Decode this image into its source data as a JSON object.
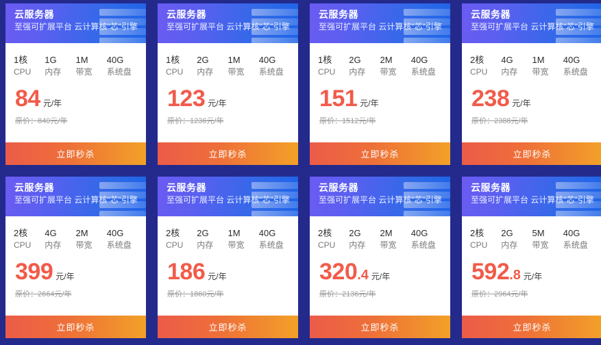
{
  "page": {
    "background_color": "#232a8c",
    "header_gradient": [
      "#6b5bf2",
      "#1f63e8"
    ],
    "button_gradient": [
      "#ec5b49",
      "#f2a128"
    ],
    "price_color": "#f15b4a"
  },
  "common": {
    "title": "云服务器",
    "subtitle": "至强可扩展平台 云计算核\"芯\"引擎",
    "buy_label": "立即秒杀",
    "price_unit": "元/年",
    "spec_labels": [
      "CPU",
      "内存",
      "带宽",
      "系统盘"
    ],
    "server-art-icon": "server-stack-icon"
  },
  "cards": [
    {
      "title": "云服务器",
      "subtitle": "至强可扩展平台 云计算核\"芯\"引擎",
      "specs": [
        {
          "value": "1核",
          "label": "CPU"
        },
        {
          "value": "1G",
          "label": "内存"
        },
        {
          "value": "1M",
          "label": "带宽"
        },
        {
          "value": "40G",
          "label": "系统盘"
        }
      ],
      "price_int": "84",
      "price_dec": "",
      "price_unit": "元/年",
      "original_price": "原价：840元/年",
      "buy_label": "立即秒杀"
    },
    {
      "title": "云服务器",
      "subtitle": "至强可扩展平台 云计算核\"芯\"引擎",
      "specs": [
        {
          "value": "1核",
          "label": "CPU"
        },
        {
          "value": "2G",
          "label": "内存"
        },
        {
          "value": "1M",
          "label": "带宽"
        },
        {
          "value": "40G",
          "label": "系统盘"
        }
      ],
      "price_int": "123",
      "price_dec": "",
      "price_unit": "元/年",
      "original_price": "原价：1236元/年",
      "buy_label": "立即秒杀"
    },
    {
      "title": "云服务器",
      "subtitle": "至强可扩展平台 云计算核\"芯\"引擎",
      "specs": [
        {
          "value": "1核",
          "label": "CPU"
        },
        {
          "value": "2G",
          "label": "内存"
        },
        {
          "value": "2M",
          "label": "带宽"
        },
        {
          "value": "40G",
          "label": "系统盘"
        }
      ],
      "price_int": "151",
      "price_dec": "",
      "price_unit": "元/年",
      "original_price": "原价：1512元/年",
      "buy_label": "立即秒杀"
    },
    {
      "title": "云服务器",
      "subtitle": "至强可扩展平台 云计算核\"芯\"引擎",
      "specs": [
        {
          "value": "2核",
          "label": "CPU"
        },
        {
          "value": "4G",
          "label": "内存"
        },
        {
          "value": "1M",
          "label": "带宽"
        },
        {
          "value": "40G",
          "label": "系统盘"
        }
      ],
      "price_int": "238",
      "price_dec": "",
      "price_unit": "元/年",
      "original_price": "原价：2388元/年",
      "buy_label": "立即秒杀"
    },
    {
      "title": "云服务器",
      "subtitle": "至强可扩展平台 云计算核\"芯\"引擎",
      "specs": [
        {
          "value": "2核",
          "label": "CPU"
        },
        {
          "value": "4G",
          "label": "内存"
        },
        {
          "value": "2M",
          "label": "带宽"
        },
        {
          "value": "40G",
          "label": "系统盘"
        }
      ],
      "price_int": "399",
      "price_dec": "",
      "price_unit": "元/年",
      "original_price": "原价：2664元/年",
      "buy_label": "立即秒杀"
    },
    {
      "title": "云服务器",
      "subtitle": "至强可扩展平台 云计算核\"芯\"引擎",
      "specs": [
        {
          "value": "2核",
          "label": "CPU"
        },
        {
          "value": "2G",
          "label": "内存"
        },
        {
          "value": "1M",
          "label": "带宽"
        },
        {
          "value": "40G",
          "label": "系统盘"
        }
      ],
      "price_int": "186",
      "price_dec": "",
      "price_unit": "元/年",
      "original_price": "原价：1860元/年",
      "buy_label": "立即秒杀"
    },
    {
      "title": "云服务器",
      "subtitle": "至强可扩展平台 云计算核\"芯\"引擎",
      "specs": [
        {
          "value": "2核",
          "label": "CPU"
        },
        {
          "value": "2G",
          "label": "内存"
        },
        {
          "value": "2M",
          "label": "带宽"
        },
        {
          "value": "40G",
          "label": "系统盘"
        }
      ],
      "price_int": "320",
      "price_dec": ".4",
      "price_unit": "元/年",
      "original_price": "原价：2136元/年",
      "buy_label": "立即秒杀"
    },
    {
      "title": "云服务器",
      "subtitle": "至强可扩展平台 云计算核\"芯\"引擎",
      "specs": [
        {
          "value": "2核",
          "label": "CPU"
        },
        {
          "value": "2G",
          "label": "内存"
        },
        {
          "value": "5M",
          "label": "带宽"
        },
        {
          "value": "40G",
          "label": "系统盘"
        }
      ],
      "price_int": "592",
      "price_dec": ".8",
      "price_unit": "元/年",
      "original_price": "原价：2964元/年",
      "buy_label": "立即秒杀"
    }
  ]
}
